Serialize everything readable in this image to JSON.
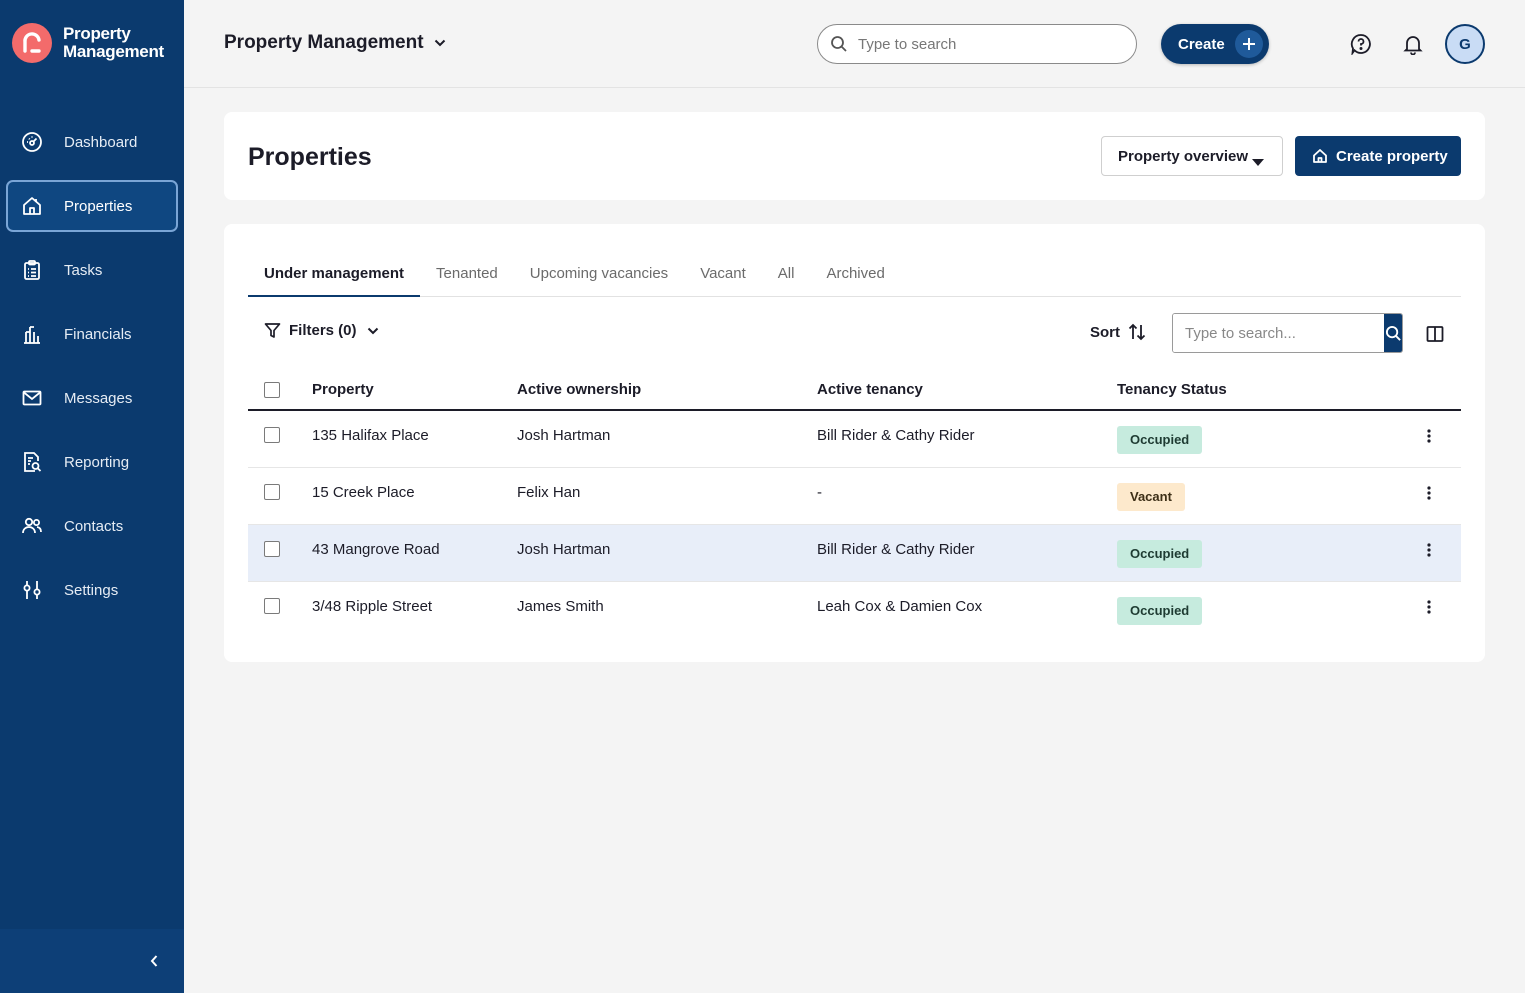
{
  "brand": {
    "line1": "Property",
    "line2": "Management",
    "logo_color": "#f36b6b"
  },
  "nav": {
    "items": [
      {
        "label": "Dashboard",
        "icon": "dashboard-icon"
      },
      {
        "label": "Properties",
        "icon": "home-icon",
        "active": true
      },
      {
        "label": "Tasks",
        "icon": "clipboard-icon"
      },
      {
        "label": "Financials",
        "icon": "bank-icon"
      },
      {
        "label": "Messages",
        "icon": "mail-icon"
      },
      {
        "label": "Reporting",
        "icon": "report-icon"
      },
      {
        "label": "Contacts",
        "icon": "people-icon"
      },
      {
        "label": "Settings",
        "icon": "sliders-icon"
      }
    ]
  },
  "topbar": {
    "app_title": "Property Management",
    "search_placeholder": "Type to search",
    "create_label": "Create",
    "avatar_initial": "G"
  },
  "header": {
    "title": "Properties",
    "overview_label": "Property overview",
    "create_property_label": "Create property"
  },
  "tabs": [
    "Under management",
    "Tenanted",
    "Upcoming vacancies",
    "Vacant",
    "All",
    "Archived"
  ],
  "toolbar": {
    "filters_label": "Filters (0)",
    "sort_label": "Sort",
    "search_placeholder": "Type to search..."
  },
  "table": {
    "columns": [
      "Property",
      "Active ownership",
      "Active tenancy",
      "Tenancy Status"
    ],
    "rows": [
      {
        "property": "135 Halifax Place",
        "ownership": "Josh Hartman",
        "tenancy": "Bill Rider & Cathy Rider",
        "status": "Occupied"
      },
      {
        "property": "15 Creek Place",
        "ownership": "Felix Han",
        "tenancy": "-",
        "status": "Vacant"
      },
      {
        "property": "43 Mangrove Road",
        "ownership": "Josh Hartman",
        "tenancy": "Bill Rider & Cathy Rider",
        "status": "Occupied"
      },
      {
        "property": "3/48 Ripple Street",
        "ownership": "James Smith",
        "tenancy": "Leah Cox & Damien Cox",
        "status": "Occupied"
      }
    ]
  },
  "colors": {
    "primary": "#0b3a6e",
    "occupied_bg": "#c6ebde",
    "vacant_bg": "#fde9cc",
    "highlight_row": "#e8eef9"
  }
}
